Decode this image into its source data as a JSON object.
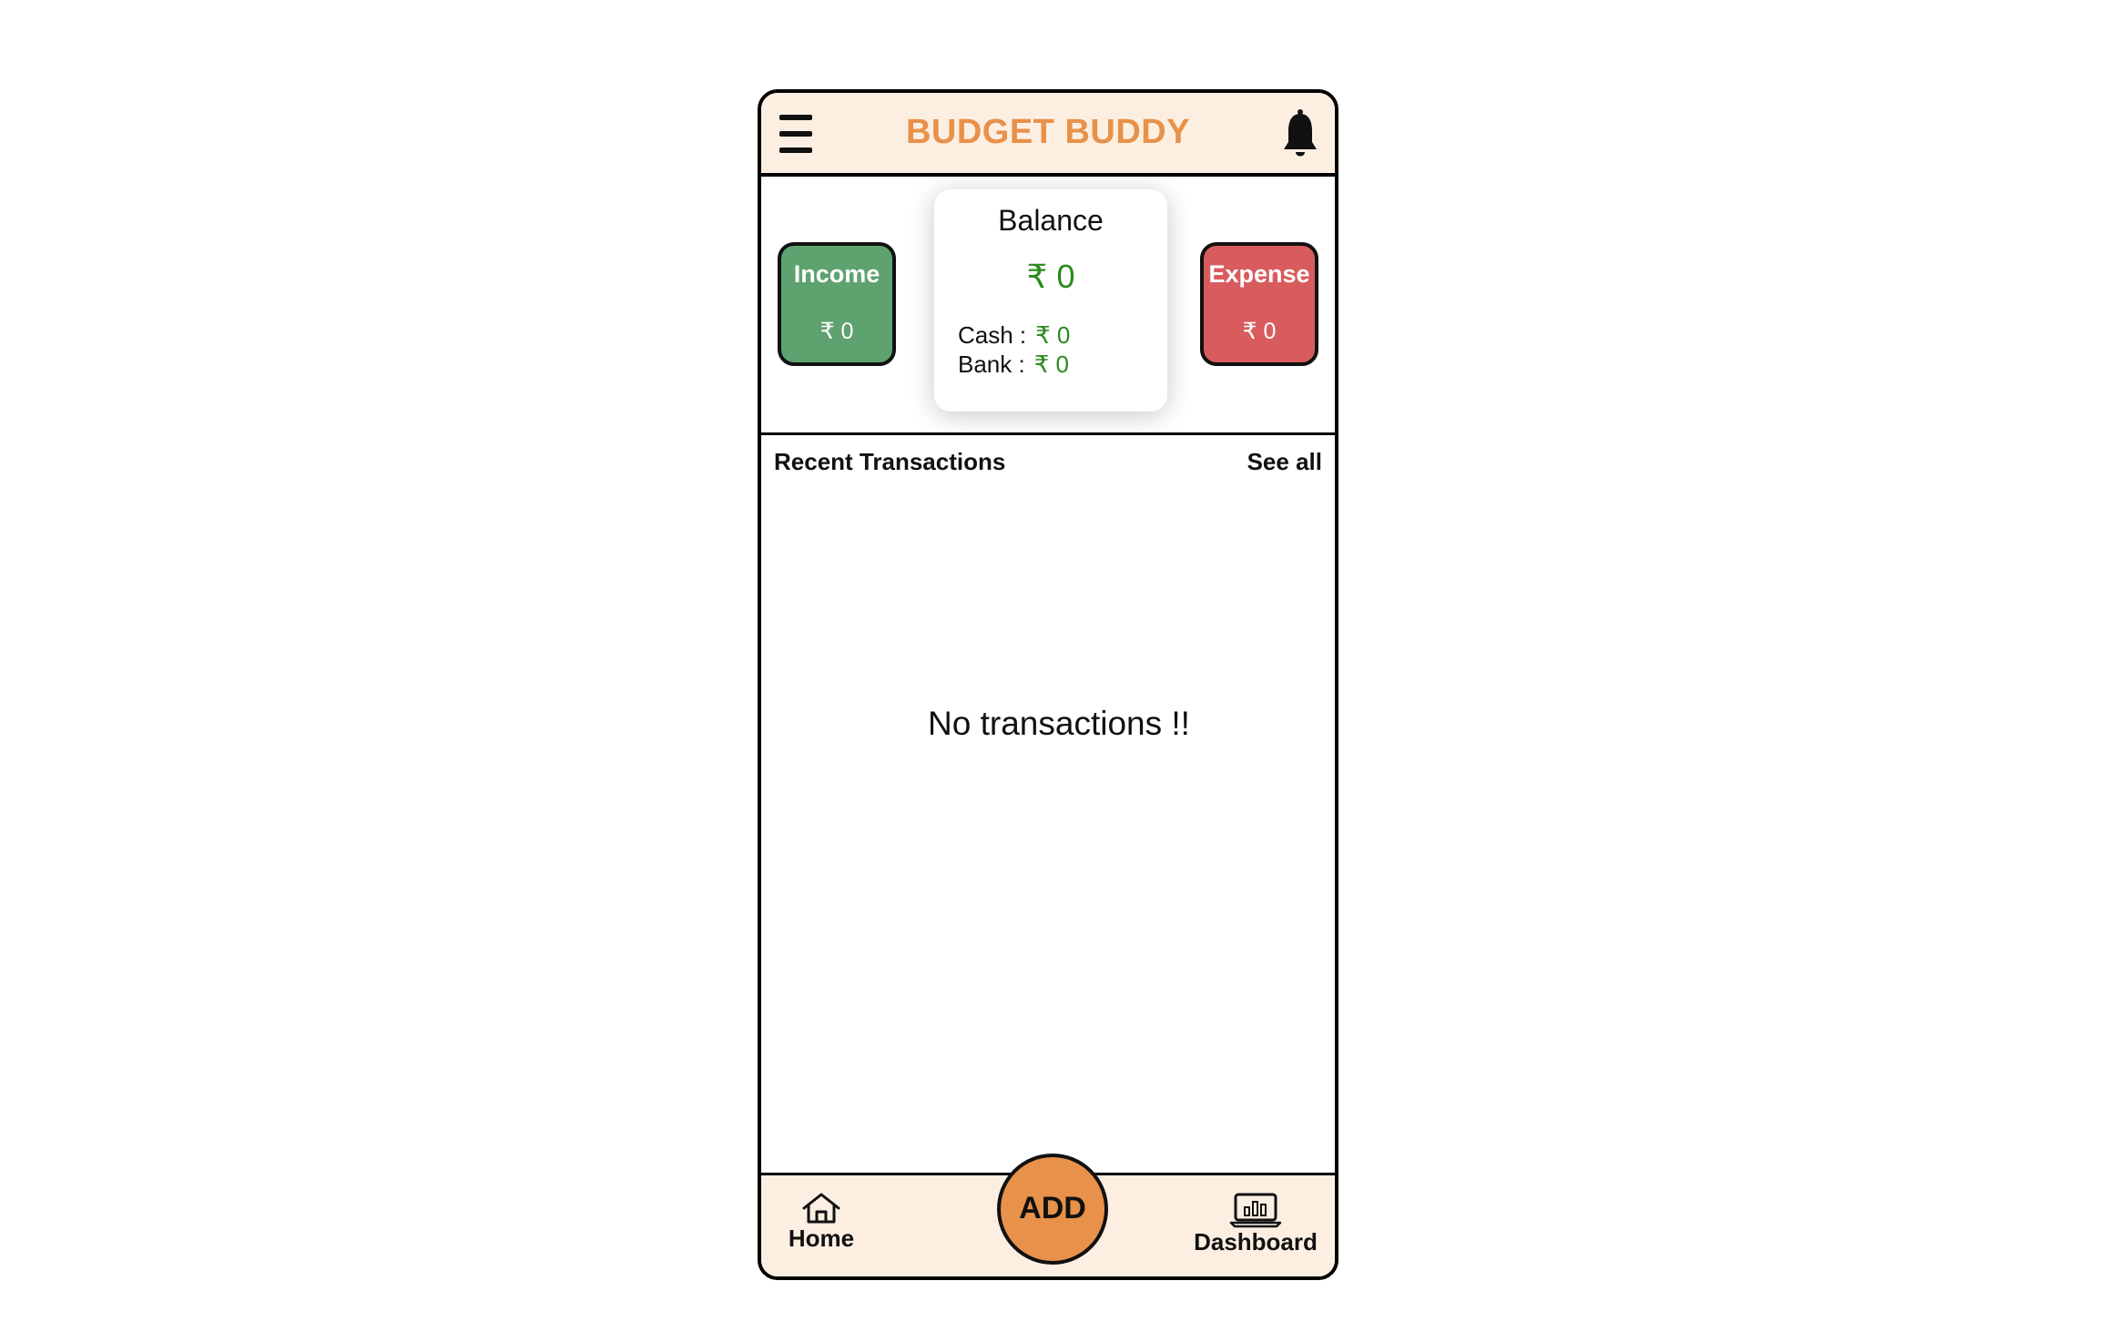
{
  "app": {
    "title": "BUDGET BUDDY",
    "accent_color": "#e8914a",
    "header_bg": "#fcefe2"
  },
  "header": {
    "menu_icon": "hamburger-menu-icon",
    "notification_icon": "bell-icon"
  },
  "summary": {
    "income": {
      "label": "Income",
      "value": "₹ 0",
      "color": "#5ea270"
    },
    "expense": {
      "label": "Expense",
      "value": "₹ 0",
      "color": "#d85c5e"
    },
    "balance": {
      "title": "Balance",
      "amount": "₹ 0",
      "cash_label": "Cash :",
      "cash_value": "₹ 0",
      "bank_label": "Bank :",
      "bank_value": "₹ 0",
      "value_color": "#2a8a1c"
    }
  },
  "recent": {
    "title": "Recent Transactions",
    "see_all": "See all",
    "empty_message": "No transactions !!"
  },
  "bottom_nav": {
    "home_label": "Home",
    "home_icon": "home-icon",
    "add_label": "ADD",
    "dashboard_label": "Dashboard",
    "dashboard_icon": "laptop-chart-icon"
  }
}
